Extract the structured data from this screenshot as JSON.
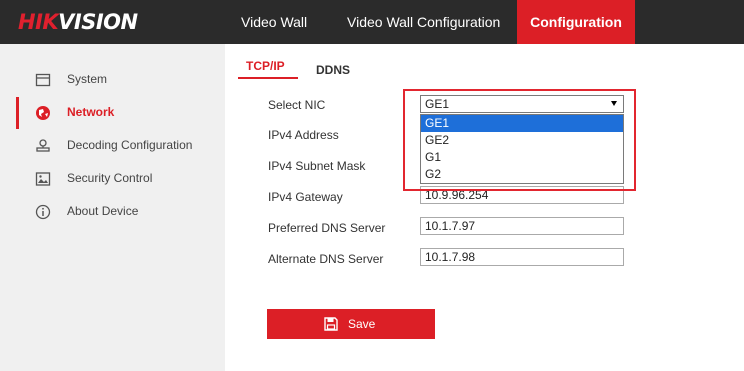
{
  "header": {
    "logo_part1": "HIK",
    "logo_part2": "VISION",
    "nav": [
      "Video Wall",
      "Video Wall Configuration",
      "Configuration"
    ]
  },
  "sidebar": {
    "items": [
      {
        "label": "System",
        "icon": "monitor-icon"
      },
      {
        "label": "Network",
        "icon": "network-globe-icon",
        "active": true
      },
      {
        "label": "Decoding Configuration",
        "icon": "decoder-icon"
      },
      {
        "label": "Security Control",
        "icon": "security-image-icon"
      },
      {
        "label": "About Device",
        "icon": "info-icon"
      }
    ]
  },
  "tabs": [
    "TCP/IP",
    "DDNS"
  ],
  "form": {
    "select_nic_label": "Select NIC",
    "select_nic_value": "GE1",
    "nic_options": [
      "GE1",
      "GE2",
      "G1",
      "G2"
    ],
    "ipv4_address_label": "IPv4 Address",
    "ipv4_subnet_label": "IPv4 Subnet Mask",
    "ipv4_gateway_label": "IPv4 Gateway",
    "ipv4_gateway_value": "10.9.96.254",
    "preferred_dns_label": "Preferred DNS Server",
    "preferred_dns_value": "10.1.7.97",
    "alternate_dns_label": "Alternate DNS Server",
    "alternate_dns_value": "10.1.7.98"
  },
  "save_label": "Save",
  "colors": {
    "accent": "#dc1f26",
    "header_bg": "#2b2b2b",
    "sidebar_bg": "#f0f0f0",
    "selection": "#1e6fd9"
  }
}
